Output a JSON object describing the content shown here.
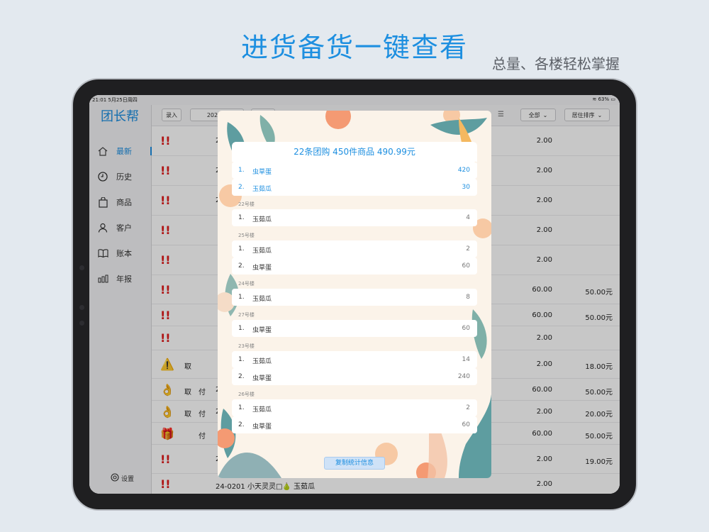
{
  "promo": {
    "headline": "进货备货一键查看",
    "subline": "总量、各楼轻松掌握"
  },
  "statusbar": {
    "time": "21:01  5月25日周四",
    "battery": "63%"
  },
  "sidebar": {
    "brand": "团长帮",
    "items": [
      {
        "label": "最新",
        "icon": "home-icon",
        "active": true
      },
      {
        "label": "历史",
        "icon": "clock-icon"
      },
      {
        "label": "商品",
        "icon": "bag-icon"
      },
      {
        "label": "客户",
        "icon": "person-icon"
      },
      {
        "label": "账本",
        "icon": "book-icon"
      },
      {
        "label": "年报",
        "icon": "bar-chart-icon"
      }
    ],
    "settings": "设置"
  },
  "toolbar": {
    "entry": "录入",
    "date": "2023-0",
    "all": "全部",
    "sort": "居住排序"
  },
  "rows": [
    {
      "icon": "!!",
      "col2": "2",
      "p1": "2.00",
      "p2": ""
    },
    {
      "icon": "!!",
      "col2": "2",
      "p1": "2.00",
      "p2": ""
    },
    {
      "icon": "!!",
      "col2": "2",
      "p1": "2.00",
      "p2": ""
    },
    {
      "icon": "!!",
      "col2": "",
      "p1": "2.00",
      "p2": ""
    },
    {
      "icon": "!!",
      "col2": "",
      "p1": "2.00",
      "p2": ""
    },
    {
      "icon": "!!",
      "col2": "",
      "p1": "60.00",
      "p2": "50.00元"
    },
    {
      "icon": "!!",
      "col2": "",
      "p1": "60.00",
      "p2": "50.00元"
    },
    {
      "icon": "!!",
      "col2": "",
      "p1": "2.00",
      "p2": ""
    },
    {
      "icon": "⚠️",
      "tag": "取",
      "col2": "",
      "p1": "2.00",
      "p2": "18.00元"
    },
    {
      "icon": "👌",
      "tag": "取",
      "tag2": "付",
      "col2": "2",
      "p1": "60.00",
      "p2": "50.00元"
    },
    {
      "icon": "👌",
      "tag": "取",
      "tag2": "付",
      "col2": "2",
      "p1": "2.00",
      "p2": "20.00元"
    },
    {
      "icon": "🎁",
      "tag": "",
      "tag2": "付",
      "col2": "",
      "p1": "60.00",
      "p2": "50.00元"
    },
    {
      "icon": "!!",
      "col2": "2",
      "p1": "2.00",
      "p2": "19.00元"
    },
    {
      "icon": "!!",
      "col2": "24-0201  小天灵灵□🍐  玉茹瓜",
      "p1": "2.00",
      "p2": ""
    }
  ],
  "modal": {
    "summary": "22条团购 450件商品 490.99元",
    "totals": [
      {
        "n": "1.",
        "name": "虫草蛋",
        "qty": "420"
      },
      {
        "n": "2.",
        "name": "玉茹瓜",
        "qty": "30"
      }
    ],
    "sections": [
      {
        "label": "22号楼",
        "items": [
          {
            "n": "1.",
            "name": "玉茹瓜",
            "qty": "4"
          }
        ]
      },
      {
        "label": "25号楼",
        "items": [
          {
            "n": "1.",
            "name": "玉茹瓜",
            "qty": "2"
          },
          {
            "n": "2.",
            "name": "虫草蛋",
            "qty": "60"
          }
        ]
      },
      {
        "label": "24号楼",
        "items": [
          {
            "n": "1.",
            "name": "玉茹瓜",
            "qty": "8"
          }
        ]
      },
      {
        "label": "27号楼",
        "items": [
          {
            "n": "1.",
            "name": "虫草蛋",
            "qty": "60"
          }
        ]
      },
      {
        "label": "23号楼",
        "items": [
          {
            "n": "1.",
            "name": "玉茹瓜",
            "qty": "14"
          },
          {
            "n": "2.",
            "name": "虫草蛋",
            "qty": "240"
          }
        ]
      },
      {
        "label": "26号楼",
        "items": [
          {
            "n": "1.",
            "name": "玉茹瓜",
            "qty": "2"
          },
          {
            "n": "2.",
            "name": "虫草蛋",
            "qty": "60"
          }
        ]
      }
    ],
    "copy_button": "复制统计信息"
  }
}
